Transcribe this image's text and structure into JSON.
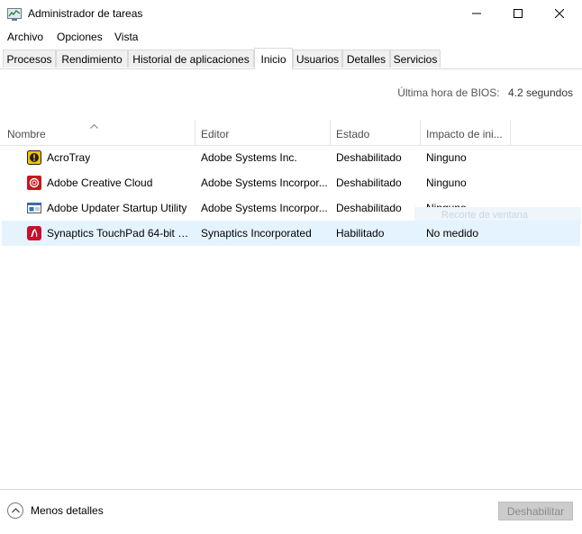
{
  "window": {
    "title": "Administrador de tareas"
  },
  "menu": [
    "Archivo",
    "Opciones",
    "Vista"
  ],
  "tabs": [
    {
      "label": "Procesos"
    },
    {
      "label": "Rendimiento"
    },
    {
      "label": "Historial de aplicaciones"
    },
    {
      "label": "Inicio",
      "active": true
    },
    {
      "label": "Usuarios"
    },
    {
      "label": "Detalles"
    },
    {
      "label": "Servicios"
    }
  ],
  "bios": {
    "label": "Última hora de BIOS:",
    "value": "4.2 segundos"
  },
  "columns": [
    "Nombre",
    "Editor",
    "Estado",
    "Impacto de ini..."
  ],
  "rows": [
    {
      "name": "AcroTray",
      "publisher": "Adobe Systems Inc.",
      "status": "Deshabilitado",
      "impact": "Ninguno",
      "icon": "acrotray-icon"
    },
    {
      "name": "Adobe Creative Cloud",
      "publisher": "Adobe Systems Incorpor...",
      "status": "Deshabilitado",
      "impact": "Ninguno",
      "icon": "creative-cloud-icon"
    },
    {
      "name": "Adobe Updater Startup Utility",
      "publisher": "Adobe Systems Incorpor...",
      "status": "Deshabilitado",
      "impact": "Ninguno",
      "icon": "adobe-updater-icon"
    },
    {
      "name": "Synaptics TouchPad 64-bit E...",
      "publisher": "Synaptics Incorporated",
      "status": "Habilitado",
      "impact": "No medido",
      "icon": "synaptics-icon",
      "selected": true
    }
  ],
  "ghost_tooltip": "Recorte de ventana",
  "footer": {
    "less_details": "Menos detalles",
    "disable_button": "Deshabilitar"
  },
  "colors": {
    "selection": "#e5f3ff",
    "disabled_button": "#cccccc"
  }
}
